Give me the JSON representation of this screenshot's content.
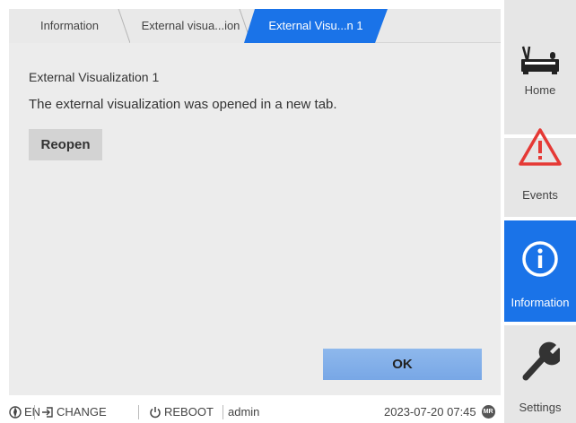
{
  "tabs": [
    {
      "label": "Information",
      "active": false
    },
    {
      "label": "External visua...ion",
      "active": false
    },
    {
      "label": "External Visu...n 1",
      "active": true
    }
  ],
  "content": {
    "subtitle": "External Visualization 1",
    "message": "The external visualization was opened in a new tab.",
    "reopen_label": "Reopen",
    "ok_label": "OK"
  },
  "statusbar": {
    "language": "EN",
    "change": "CHANGE",
    "reboot": "REBOOT",
    "user": "admin",
    "datetime": "2023-07-20 07:45",
    "badge": "MR"
  },
  "nav": [
    {
      "label": "Home",
      "icon": "home-device-icon",
      "active": false
    },
    {
      "label": "Events",
      "icon": "warning-triangle-icon",
      "active": false,
      "color": "#e53935"
    },
    {
      "label": "Information",
      "icon": "info-circle-icon",
      "active": true
    },
    {
      "label": "Settings",
      "icon": "wrench-icon",
      "active": false
    }
  ],
  "colors": {
    "accent": "#1a73e8",
    "ok_button": "#82aeea",
    "warning": "#e53935"
  }
}
